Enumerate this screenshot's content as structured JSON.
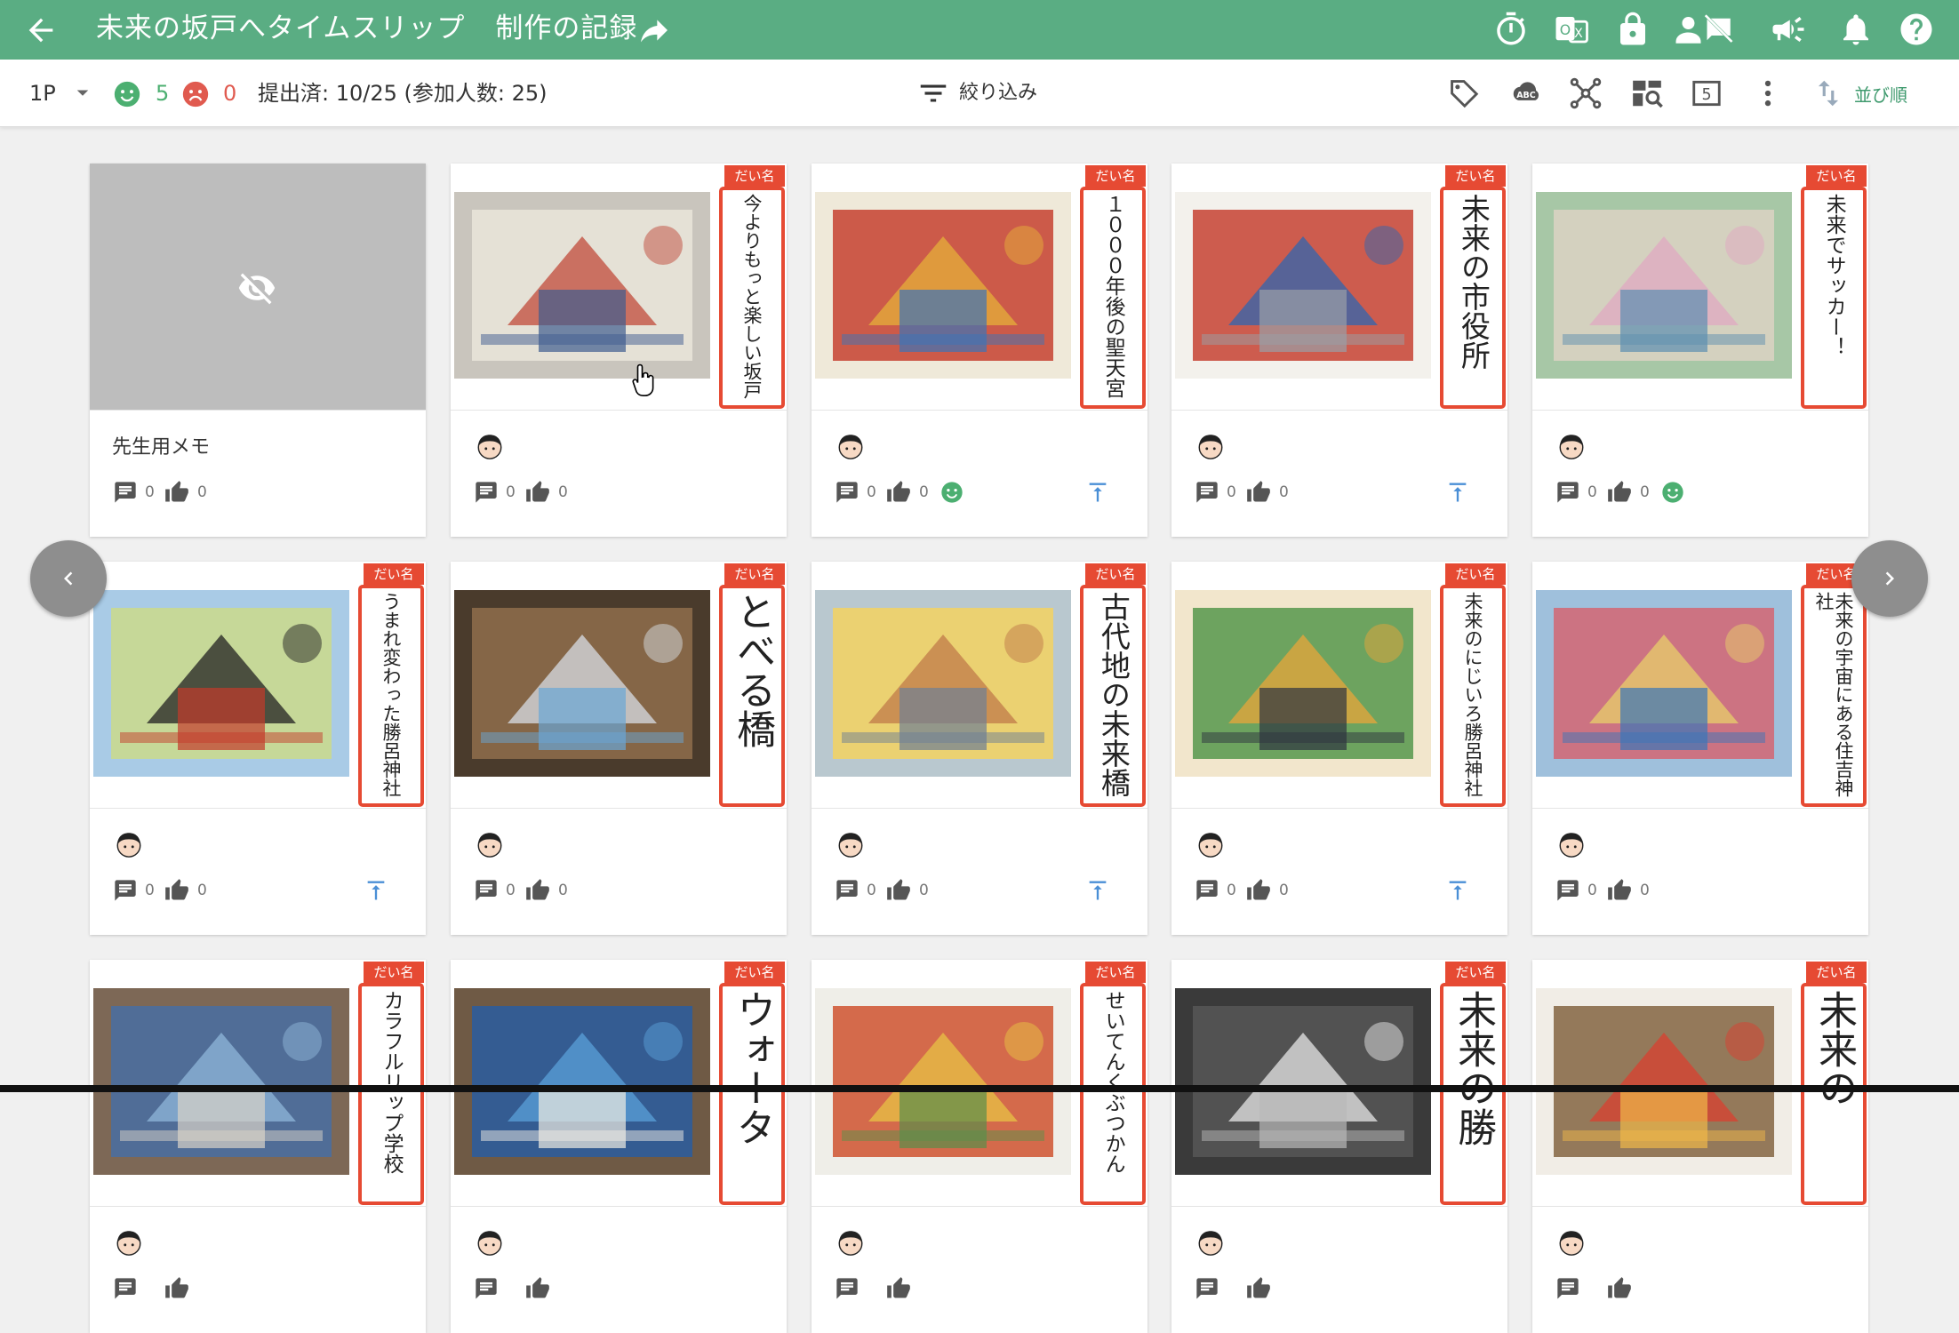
{
  "appbar": {
    "title": "未来の坂戸へタイムスリップ",
    "subtitle": "制作の記録",
    "color": "#5aad83",
    "icons": [
      "back-arrow-icon",
      "share-arrow-icon",
      "timer-icon",
      "translate-icon",
      "lock-icon",
      "hide-names-icon",
      "announce-icon",
      "bell-icon",
      "help-icon"
    ]
  },
  "toolbar": {
    "page": "1P",
    "positive_count": "5",
    "negative_count": "0",
    "submitted": "提出済: 10/25 (参加人数: 25)",
    "filter_label": "絞り込み",
    "sort_label": "並び順",
    "icons": [
      "tag-icon",
      "spellcheck-icon",
      "mind-map-icon",
      "image-search-icon",
      "counter-5-icon",
      "more-vert-icon",
      "sort-icon"
    ]
  },
  "tag_label": "だい名",
  "memo": {
    "title": "先生用メモ",
    "comments": "0",
    "likes": "0"
  },
  "cards": [
    {
      "title": "今よりもっと楽しい坂戸",
      "comments": "0",
      "likes": "0",
      "reaction": "none",
      "pinned": false
    },
    {
      "title": "１０００年後の聖天宮",
      "comments": "0",
      "likes": "0",
      "reaction": "smile",
      "pinned": true
    },
    {
      "title": "未来の市役所",
      "comments": "0",
      "likes": "0",
      "reaction": "none",
      "pinned": true
    },
    {
      "title": "未来でサッカー！",
      "comments": "0",
      "likes": "0",
      "reaction": "smile",
      "pinned": false
    },
    {
      "title": "うまれ変わった勝呂神社",
      "comments": "0",
      "likes": "0",
      "reaction": "none",
      "pinned": true
    },
    {
      "title": "とべる橋",
      "comments": "0",
      "likes": "0",
      "reaction": "none",
      "pinned": false
    },
    {
      "title": "古代地の未来橋",
      "comments": "0",
      "likes": "0",
      "reaction": "none",
      "pinned": true
    },
    {
      "title": "未来のにじいろ勝呂神社",
      "comments": "0",
      "likes": "0",
      "reaction": "none",
      "pinned": true
    },
    {
      "title": "未来の宇宙にある住吉神社",
      "comments": "0",
      "likes": "0",
      "reaction": "none",
      "pinned": false
    },
    {
      "title": "カラフルリップ学校",
      "comments": "",
      "likes": "",
      "reaction": "none",
      "pinned": false
    },
    {
      "title": "ウォータ",
      "comments": "",
      "likes": "",
      "reaction": "none",
      "pinned": false
    },
    {
      "title": "せいてんくぶつかん",
      "comments": "",
      "likes": "",
      "reaction": "none",
      "pinned": false
    },
    {
      "title": "未来の勝",
      "comments": "",
      "likes": "",
      "reaction": "none",
      "pinned": false
    },
    {
      "title": "未来の",
      "comments": "",
      "likes": "",
      "reaction": "none",
      "pinned": false
    }
  ]
}
